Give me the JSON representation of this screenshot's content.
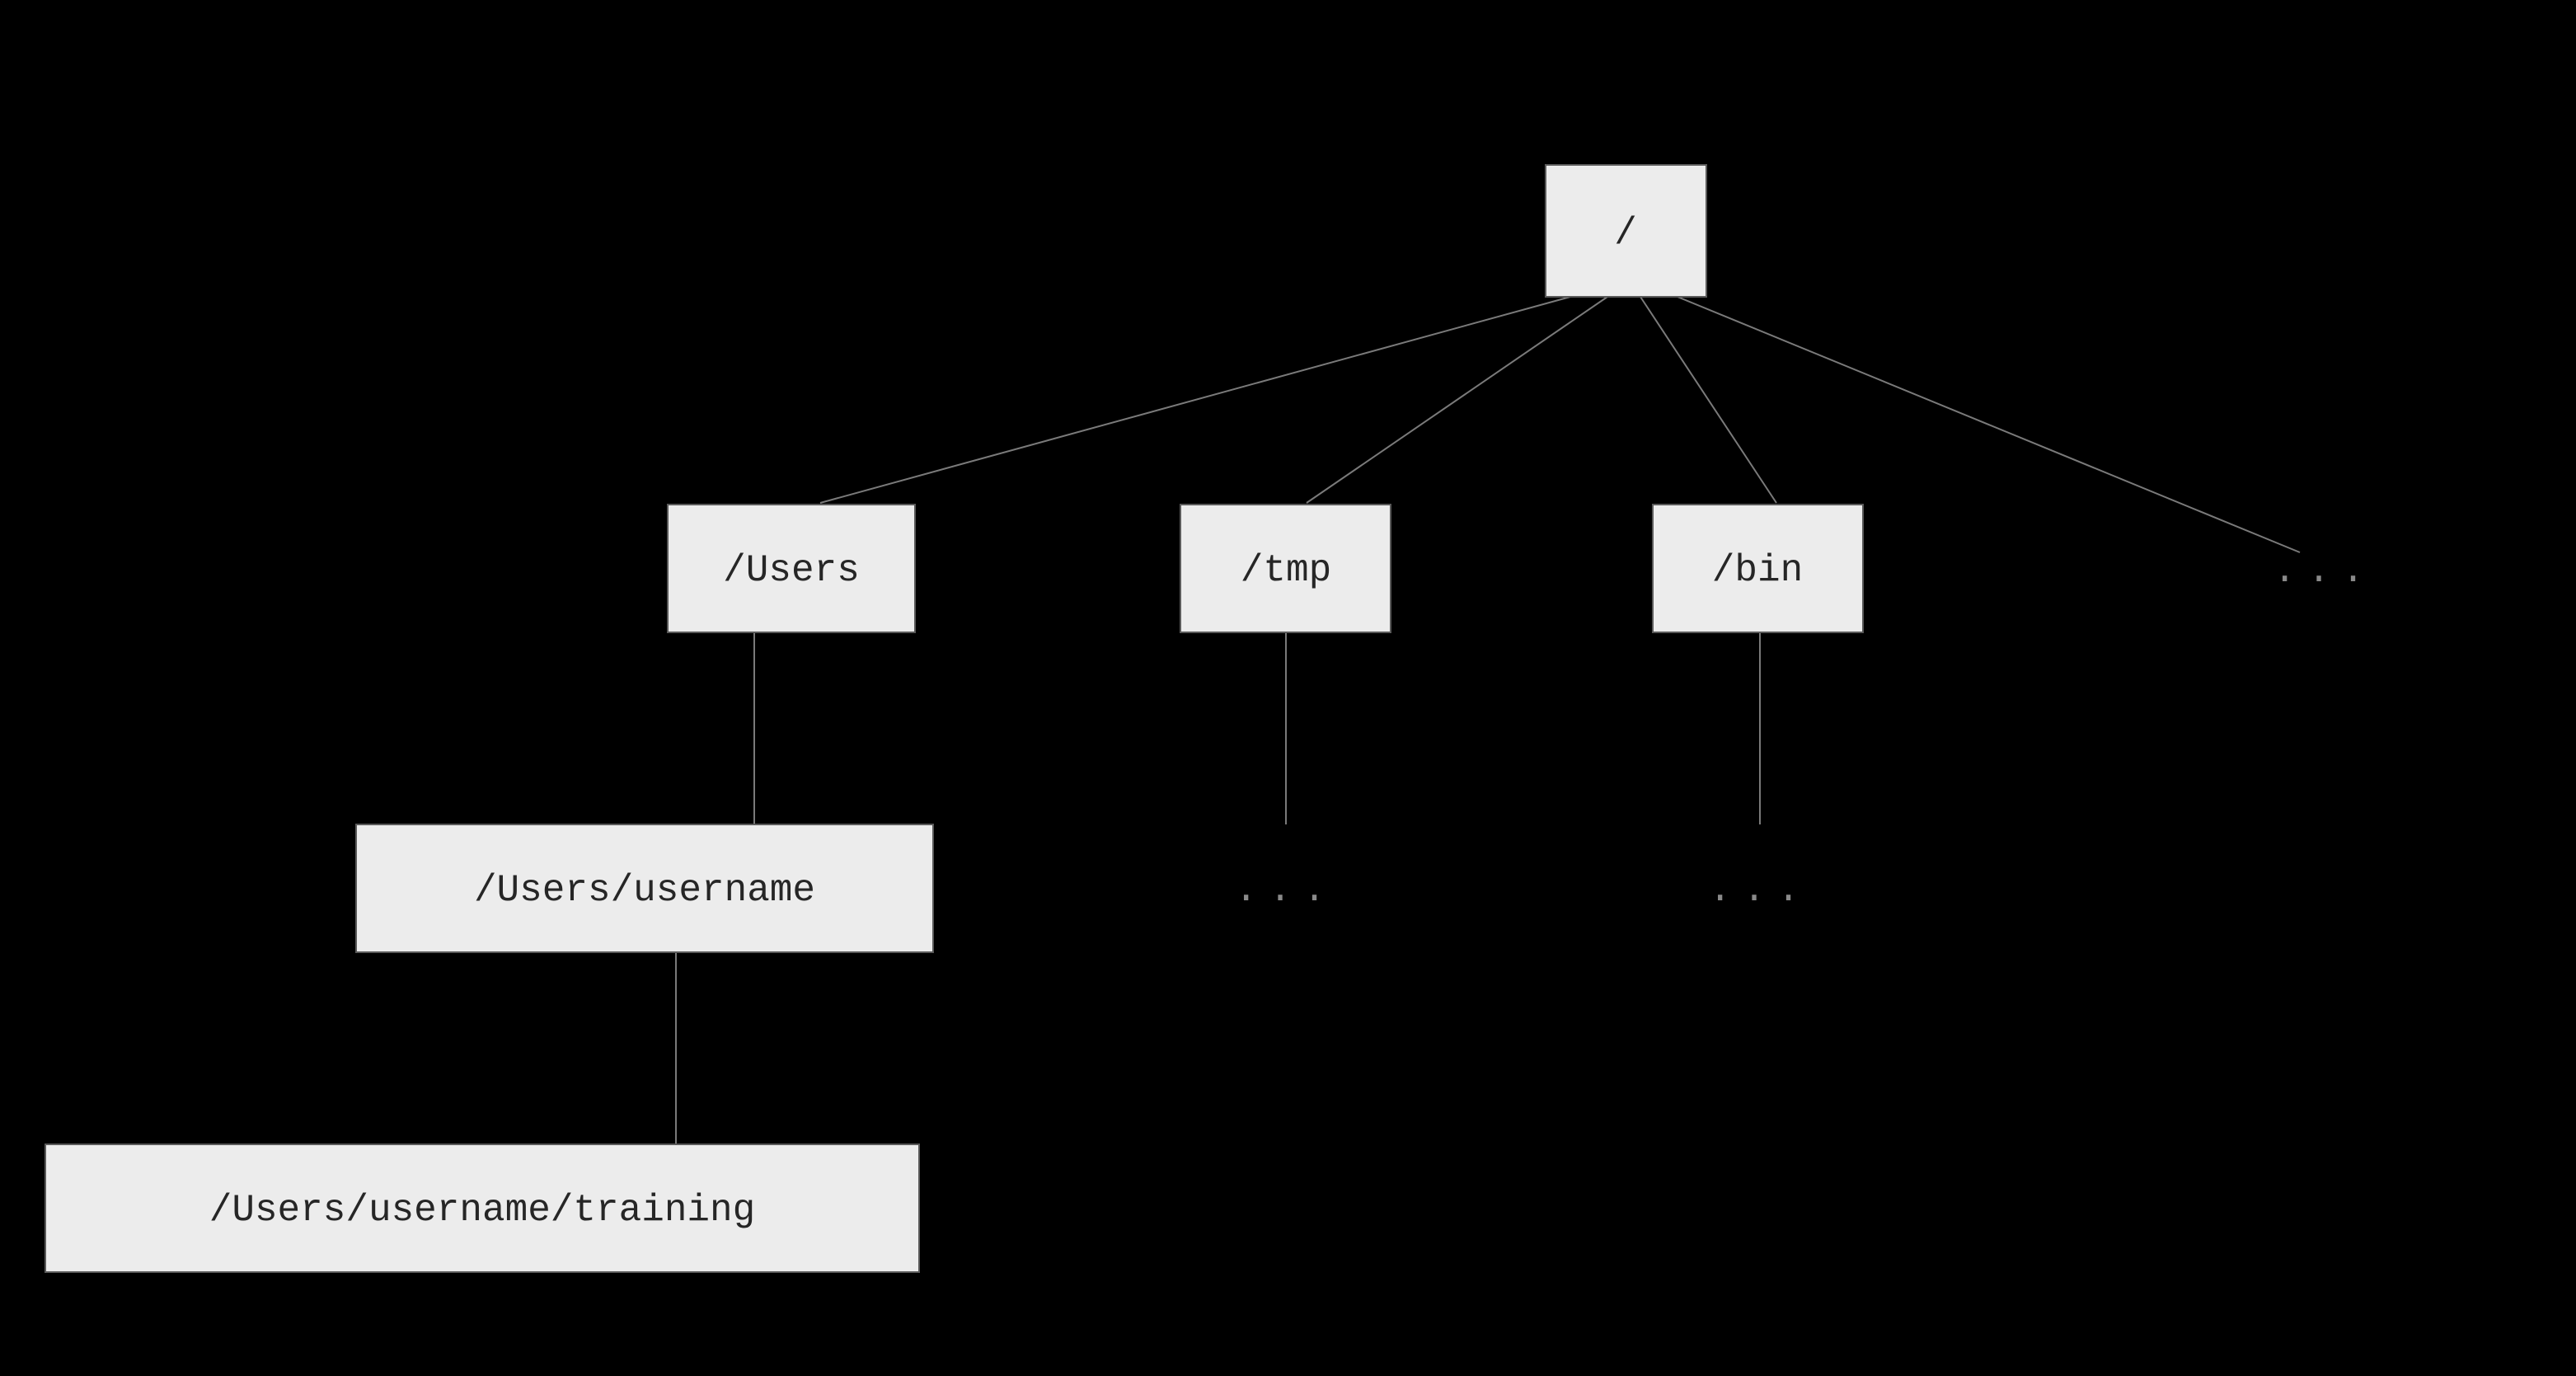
{
  "diagram": {
    "root": "/",
    "level1_users": "/Users",
    "level1_tmp": "/tmp",
    "level1_bin": "/bin",
    "level1_more": "...",
    "level2_username": "/Users/username",
    "level2_tmp_more": "...",
    "level2_bin_more": "...",
    "level3_training": "/Users/username/training"
  }
}
